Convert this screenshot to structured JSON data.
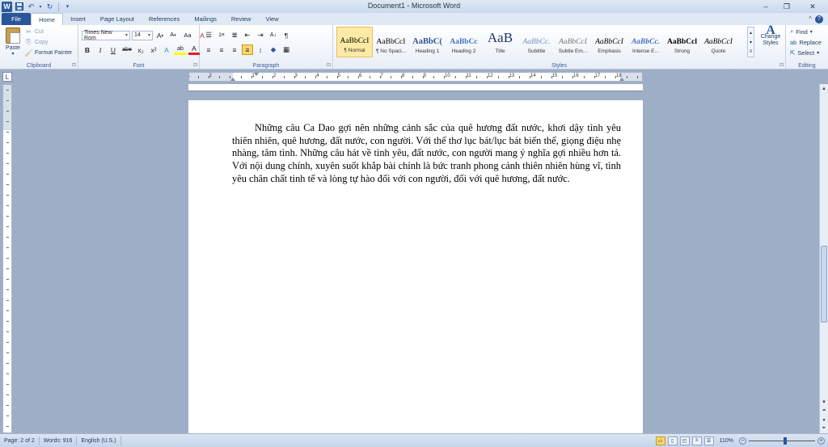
{
  "title": "Document1 - Microsoft Word",
  "quick_access": {
    "app_icon": "W",
    "save_icon": "save-icon",
    "undo_icon": "undo-icon",
    "redo_icon": "redo-icon"
  },
  "window_controls": [
    "–",
    "❐",
    "✕"
  ],
  "tabs": [
    "File",
    "Home",
    "Insert",
    "Page Layout",
    "References",
    "Mailings",
    "Review",
    "View"
  ],
  "active_tab": "Home",
  "help_icons": [
    "^",
    "?"
  ],
  "clipboard": {
    "paste_label": "Paste",
    "cut_label": "Cut",
    "copy_label": "Copy",
    "format_painter_label": "Format Painter",
    "group_label": "Clipboard"
  },
  "font": {
    "font_name": "Times New Rom",
    "font_size": "14",
    "grow": "A",
    "shrink": "A",
    "change_case": "Aa",
    "clear": "A",
    "bold": "B",
    "italic": "I",
    "underline": "U",
    "strike": "abe",
    "subscript": "x₂",
    "superscript": "x²",
    "text_effects": "A",
    "highlight": "ab",
    "font_color": "A",
    "group_label": "Font"
  },
  "paragraph": {
    "bullets": "☰",
    "numbering": "1≡",
    "multilevel": "≣",
    "decrease_indent": "⇤",
    "increase_indent": "⇥",
    "sort": "A↓",
    "show_marks": "¶",
    "align_left": "≡",
    "align_center": "≡",
    "align_right": "≡",
    "justify": "≡",
    "line_spacing": "↕",
    "shading": "◆",
    "borders": "▦",
    "group_label": "Paragraph"
  },
  "styles": {
    "items": [
      {
        "sample": "AaBbCcI",
        "name": "¶ Normal"
      },
      {
        "sample": "AaBbCcI",
        "name": "¶ No Spaci..."
      },
      {
        "sample": "AaBbC(",
        "name": "Heading 1"
      },
      {
        "sample": "AaBbCc",
        "name": "Heading 2"
      },
      {
        "sample": "AaB",
        "name": "Title"
      },
      {
        "sample": "AaBbCc.",
        "name": "Subtitle"
      },
      {
        "sample": "AaBbCcI",
        "name": "Subtle Em..."
      },
      {
        "sample": "AaBbCcI",
        "name": "Emphasis"
      },
      {
        "sample": "AaBbCc.",
        "name": "Intense E..."
      },
      {
        "sample": "AaBbCcl",
        "name": "Strong"
      },
      {
        "sample": "AaBbCcI",
        "name": "Quote"
      }
    ],
    "change_styles_label": "Change Styles",
    "group_label": "Styles"
  },
  "editing": {
    "find_label": "Find",
    "replace_label": "Replace",
    "select_label": "Select",
    "group_label": "Editing"
  },
  "ruler": {
    "tab_selector": "L",
    "numbers": [
      "1",
      "2",
      "1",
      "2",
      "3",
      "4",
      "5",
      "6",
      "7",
      "8",
      "9",
      "10",
      "11",
      "12",
      "13",
      "14",
      "15",
      "16",
      "17",
      "18"
    ]
  },
  "document": {
    "paragraph": "Những câu Ca Dao gợi nên những cảnh sắc của quê hương đất nước, khơi dậy tình yêu thiên nhiên, quê hương, đất nước, con người. Với thể thơ lục bát/lục bát biến thể, giọng điệu nhẹ nhàng, tâm tình.  Những câu hát về tình yêu, đất nước, con người mang ý nghĩa gợi nhiều hơn tả. Với nội dung chính, xuyên suốt khắp bài chính là bức tranh phong cảnh thiên nhiên hùng vĩ, tình yêu chân chất tinh tế và lòng tự hào đối với con người, đối với quê hương, đất nước."
  },
  "status": {
    "page": "Page: 2 of 2",
    "words": "Words: 916",
    "language": "English (U.S.)",
    "zoom": "110%",
    "zoom_fraction": 0.55
  }
}
